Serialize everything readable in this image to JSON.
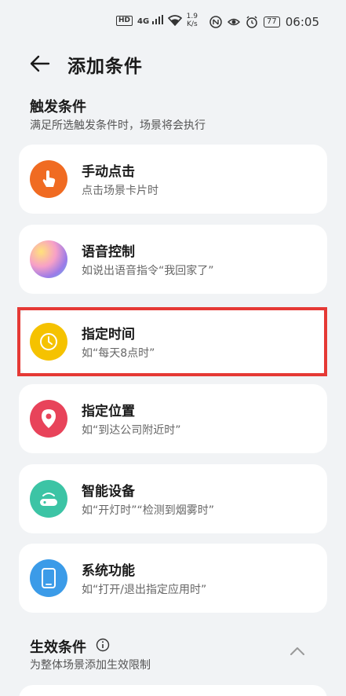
{
  "status_bar": {
    "hd": "HD",
    "signal": "4G",
    "speed_value": "1.9",
    "speed_unit": "K/s",
    "battery": "77",
    "time": "06:05"
  },
  "header": {
    "title": "添加条件"
  },
  "trigger_section": {
    "title": "触发条件",
    "subtitle": "满足所选触发条件时，场景将会执行"
  },
  "items": [
    {
      "title": "手动点击",
      "subtitle": "点击场景卡片时",
      "icon": "hand-tap-icon",
      "color": "#f06b22"
    },
    {
      "title": "语音控制",
      "subtitle": "如说出语音指令“我回家了”",
      "icon": "voice-assistant-icon",
      "color": "#c07be0"
    },
    {
      "title": "指定时间",
      "subtitle": "如“每天8点时”",
      "icon": "clock-icon",
      "color": "#f5c200"
    },
    {
      "title": "指定位置",
      "subtitle": "如“到达公司附近时”",
      "icon": "location-pin-icon",
      "color": "#e8435a"
    },
    {
      "title": "智能设备",
      "subtitle": "如“开灯时”“检测到烟雾时”",
      "icon": "smart-device-icon",
      "color": "#3cc4a5"
    },
    {
      "title": "系统功能",
      "subtitle": "如“打开/退出指定应用时”",
      "icon": "phone-icon",
      "color": "#3b9be8"
    }
  ],
  "effective_section": {
    "title": "生效条件",
    "subtitle": "为整体场景添加生效限制"
  }
}
